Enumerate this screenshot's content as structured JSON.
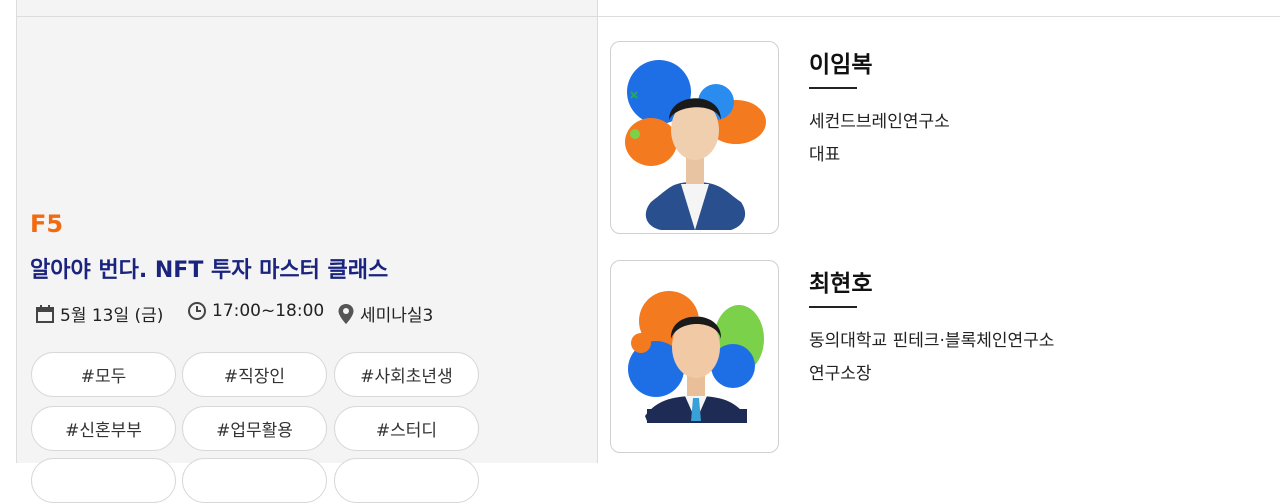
{
  "session": {
    "code": "F5",
    "title": "알아야 번다. NFT 투자 마스터 클래스",
    "date": "5월 13일 (금)",
    "time": "17:00~18:00",
    "location": "세미나실3",
    "tags": [
      "#모두",
      "#직장인",
      "#사회초년생",
      "#신혼부부",
      "#업무활용",
      "#스터디"
    ]
  },
  "speakers": [
    {
      "name": "이임복",
      "affiliation": "세컨드브레인연구소",
      "role": "대표"
    },
    {
      "name": "최현호",
      "affiliation": "동의대학교 핀테크·블록체인연구소",
      "role": "연구소장"
    }
  ],
  "colors": {
    "accent_orange": "#f26a10",
    "title_navy": "#1a237e",
    "panel_bg": "#f4f4f4"
  },
  "icons": {
    "date": "calendar-icon",
    "time": "clock-icon",
    "location": "location-pin-icon"
  }
}
